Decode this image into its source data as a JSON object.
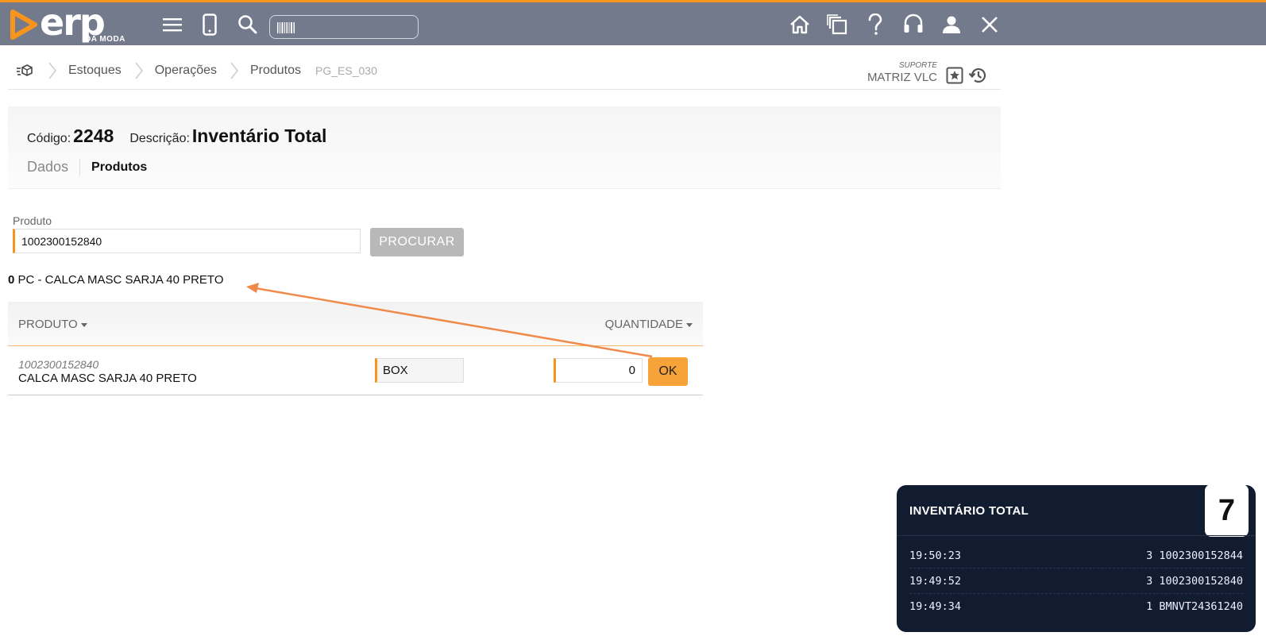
{
  "app": {
    "logo_text": "erp",
    "logo_sub": "DA MODA",
    "barcode_placeholder": ""
  },
  "breadcrumb": {
    "items": [
      "Estoques",
      "Operações",
      "Produtos"
    ],
    "page_code": "PG_ES_030"
  },
  "support": {
    "label": "SUPORTE",
    "value": "MATRIZ VLC"
  },
  "header": {
    "code_label": "Código:",
    "code": "2248",
    "desc_label": "Descrição:",
    "desc": "Inventário Total",
    "tabs": [
      "Dados",
      "Produtos"
    ],
    "active_tab": "Produtos"
  },
  "search": {
    "label": "Produto",
    "value": "1002300152840",
    "button": "PROCURAR"
  },
  "summary": {
    "qty": "0",
    "text": " PC - CALCA MASC SARJA 40 PRETO"
  },
  "table": {
    "col_produto": "PRODUTO",
    "col_quantidade": "QUANTIDADE",
    "rows": [
      {
        "code": "1002300152840",
        "name": "CALCA MASC SARJA 40 PRETO",
        "location": "BOX",
        "quantity": "0",
        "ok_label": "OK"
      }
    ]
  },
  "inventory_panel": {
    "title": "INVENTÁRIO TOTAL",
    "badge": "7",
    "entries": [
      {
        "time": "19:50:23",
        "value": "3 1002300152844"
      },
      {
        "time": "19:49:52",
        "value": "3 1002300152840"
      },
      {
        "time": "19:49:34",
        "value": "1 BMNVT24361240"
      }
    ]
  },
  "colors": {
    "topbar": "#737a8b",
    "accent": "#f7941d",
    "panel_bg": "#111c30"
  }
}
